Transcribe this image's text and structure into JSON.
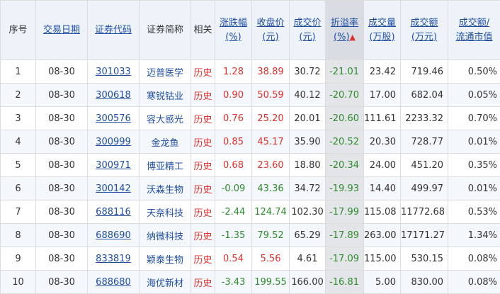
{
  "headers": {
    "index": "序号",
    "date": "交易日期",
    "code": "证券代码",
    "name": "证券简称",
    "related": "相关",
    "change_l1": "涨跌幅",
    "change_l2": "(%)",
    "close_l1": "收盘价",
    "close_l2": "(元)",
    "deal_l1": "成交价",
    "deal_l2": "(元)",
    "premium_l1": "折溢率",
    "premium_l2": "(%)",
    "volume_l1": "成交量",
    "volume_l2": "(万股)",
    "amount_l1": "成交额",
    "amount_l2": "(万元)",
    "ratio_l1": "成交额/",
    "ratio_l2": "流通市值"
  },
  "sort_arrow_icon": "arrow-up-icon",
  "colors": {
    "up": "#e0302b",
    "down": "#2e8b2e",
    "link": "#1f4fa3"
  },
  "rows": [
    {
      "index": "1",
      "date": "08-30",
      "code": "301033",
      "name": "迈普医学",
      "related": "历史",
      "change": "1.28",
      "close": "38.89",
      "deal": "30.72",
      "premium": "-21.01",
      "volume": "23.42",
      "amount": "719.46",
      "ratio": "0.50%"
    },
    {
      "index": "2",
      "date": "08-30",
      "code": "300618",
      "name": "寒锐钴业",
      "related": "历史",
      "change": "0.90",
      "close": "50.59",
      "deal": "40.12",
      "premium": "-20.70",
      "volume": "17.00",
      "amount": "682.04",
      "ratio": "0.05%"
    },
    {
      "index": "3",
      "date": "08-30",
      "code": "300576",
      "name": "容大感光",
      "related": "历史",
      "change": "0.76",
      "close": "25.20",
      "deal": "20.01",
      "premium": "-20.60",
      "volume": "111.61",
      "amount": "2233.32",
      "ratio": "0.70%"
    },
    {
      "index": "4",
      "date": "08-30",
      "code": "300999",
      "name": "金龙鱼",
      "related": "历史",
      "change": "0.85",
      "close": "45.17",
      "deal": "35.90",
      "premium": "-20.52",
      "volume": "20.30",
      "amount": "728.77",
      "ratio": "0.01%"
    },
    {
      "index": "5",
      "date": "08-30",
      "code": "300971",
      "name": "博亚精工",
      "related": "历史",
      "change": "0.68",
      "close": "23.60",
      "deal": "18.80",
      "premium": "-20.34",
      "volume": "24.00",
      "amount": "451.20",
      "ratio": "0.35%"
    },
    {
      "index": "6",
      "date": "08-30",
      "code": "300142",
      "name": "沃森生物",
      "related": "历史",
      "change": "-0.09",
      "close": "43.36",
      "deal": "34.72",
      "premium": "-19.93",
      "volume": "14.40",
      "amount": "499.97",
      "ratio": "0.01%"
    },
    {
      "index": "7",
      "date": "08-30",
      "code": "688116",
      "name": "天奈科技",
      "related": "历史",
      "change": "-2.44",
      "close": "124.74",
      "deal": "102.30",
      "premium": "-17.99",
      "volume": "115.08",
      "amount": "11772.68",
      "ratio": "0.53%"
    },
    {
      "index": "8",
      "date": "08-30",
      "code": "688690",
      "name": "纳微科技",
      "related": "历史",
      "change": "-1.35",
      "close": "79.52",
      "deal": "65.29",
      "premium": "-17.89",
      "volume": "263.00",
      "amount": "17171.27",
      "ratio": "1.34%"
    },
    {
      "index": "9",
      "date": "08-30",
      "code": "833819",
      "name": "颖泰生物",
      "related": "历史",
      "change": "0.54",
      "close": "5.56",
      "deal": "4.61",
      "premium": "-17.09",
      "volume": "115.00",
      "amount": "530.15",
      "ratio": "0.08%"
    },
    {
      "index": "10",
      "date": "08-30",
      "code": "688680",
      "name": "海优新材",
      "related": "历史",
      "change": "-3.43",
      "close": "199.55",
      "deal": "166.00",
      "premium": "-16.81",
      "volume": "5.00",
      "amount": "830.00",
      "ratio": "0.08%"
    }
  ]
}
